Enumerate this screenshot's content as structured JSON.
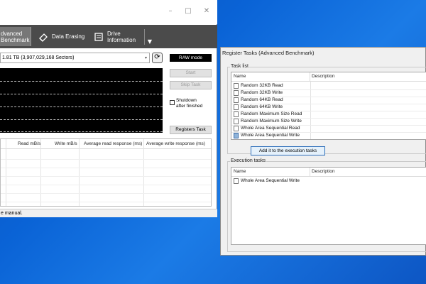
{
  "window_controls": {
    "minimize": "–",
    "maximize": "□",
    "close": "✕"
  },
  "toolbar": {
    "advanced_benchmark": "dvanced\nBenchmark",
    "data_erasing": "Data Erasing",
    "drive_information": "Drive\nInformation",
    "more": "▼"
  },
  "drive": {
    "selected": "1.81 TB (3,907,029,168 Sectors)",
    "arrow": "▾"
  },
  "controls": {
    "refresh": "⟳",
    "raw_mode": "RAW mode",
    "start": "Start",
    "skip_task": "Skip Task",
    "shutdown_label": "Shutdown\nafter finished",
    "registers_task": "Registers Task"
  },
  "results": {
    "columns": [
      "Read mB/s",
      "Write mB/s",
      "Average read response (ms)",
      "Average write response (ms)"
    ]
  },
  "status": "e manual.",
  "register_window": {
    "title": "Register Tasks (Advanced Benchmark)",
    "task_list_label": "Task list",
    "col_name": "Name",
    "col_description": "Description",
    "tasks": [
      {
        "label": "Random 32KB Read",
        "selected": false
      },
      {
        "label": "Random 32KB Write",
        "selected": false
      },
      {
        "label": "Random 64KB Read",
        "selected": false
      },
      {
        "label": "Random 64KB Write",
        "selected": false
      },
      {
        "label": "Random Maximum Size Read",
        "selected": false
      },
      {
        "label": "Random Maximum Size Write",
        "selected": false
      },
      {
        "label": "Whole Area Sequential Read",
        "selected": false
      },
      {
        "label": "Whole Area Sequential Write",
        "selected": true
      }
    ],
    "add_button": "Add it to the execution tasks",
    "execution_label": "Execution tasks",
    "execution_tasks": [
      {
        "label": "Whole Area Sequential Write"
      }
    ]
  },
  "colors": {
    "toolbar_bg": "#4b4b4b",
    "graph_bg": "#000000",
    "desktop_bg": "#0a63d6",
    "selection": "#8fb3d9"
  },
  "icons": {
    "erase": "eraser-icon",
    "drive": "drive-info-icon",
    "benchmark": "benchmark-icon"
  }
}
